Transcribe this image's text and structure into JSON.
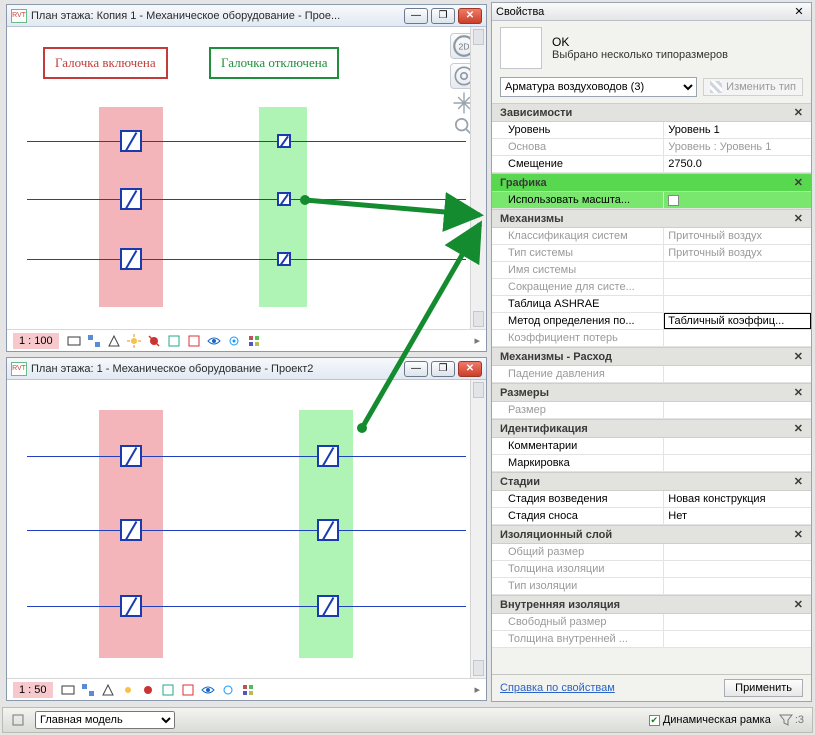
{
  "windows": {
    "top": {
      "title": "План этажа: Копия 1 - Механическое оборудование - Прое...",
      "notes": {
        "on": "Галочка включена",
        "off": "Галочка отключена"
      },
      "scale": "1 : 100"
    },
    "bottom": {
      "title": "План этажа: 1 - Механическое оборудование - Проект2",
      "scale": "1 : 50"
    }
  },
  "properties": {
    "title": "Свойства",
    "head": {
      "l1": "OK",
      "l2": "Выбрано несколько типоразмеров"
    },
    "type_selector": "Арматура воздуховодов (3)",
    "edit_type": "Изменить тип",
    "groups": [
      {
        "name": "Зависимости",
        "rows": [
          {
            "k": "Уровень",
            "v": "Уровень 1",
            "rw": true
          },
          {
            "k": "Основа",
            "v": "Уровень : Уровень 1",
            "rw": false
          },
          {
            "k": "Смещение",
            "v": "2750.0",
            "rw": true
          }
        ]
      },
      {
        "name": "Графика",
        "highlight": true,
        "rows": [
          {
            "k": "Использовать масшта...",
            "v": "",
            "checkbox": true,
            "rw": true
          }
        ]
      },
      {
        "name": "Механизмы",
        "rows": [
          {
            "k": "Классификация систем",
            "v": "Приточный воздух",
            "rw": false
          },
          {
            "k": "Тип системы",
            "v": "Приточный воздух",
            "rw": false
          },
          {
            "k": "Имя системы",
            "v": "",
            "rw": false
          },
          {
            "k": "Сокращение для систе...",
            "v": "",
            "rw": false
          },
          {
            "k": "Таблица ASHRAE",
            "v": "",
            "rw": true
          },
          {
            "k": "Метод определения по...",
            "v": "Табличный коэффиц...",
            "rw": true,
            "boxed": true
          },
          {
            "k": "Коэффициент потерь",
            "v": "",
            "rw": false
          }
        ]
      },
      {
        "name": "Механизмы - Расход",
        "rows": [
          {
            "k": "Падение давления",
            "v": "",
            "rw": false
          }
        ]
      },
      {
        "name": "Размеры",
        "rows": [
          {
            "k": "Размер",
            "v": "",
            "rw": false
          }
        ]
      },
      {
        "name": "Идентификация",
        "rows": [
          {
            "k": "Комментарии",
            "v": "",
            "rw": true
          },
          {
            "k": "Маркировка",
            "v": "",
            "rw": true
          }
        ]
      },
      {
        "name": "Стадии",
        "rows": [
          {
            "k": "Стадия возведения",
            "v": "Новая конструкция",
            "rw": true
          },
          {
            "k": "Стадия сноса",
            "v": "Нет",
            "rw": true
          }
        ]
      },
      {
        "name": "Изоляционный слой",
        "rows": [
          {
            "k": "Общий размер",
            "v": "",
            "rw": false
          },
          {
            "k": "Толщина изоляции",
            "v": "",
            "rw": false
          },
          {
            "k": "Тип изоляции",
            "v": "",
            "rw": false
          }
        ]
      },
      {
        "name": "Внутренняя изоляция",
        "rows": [
          {
            "k": "Свободный размер",
            "v": "",
            "rw": false
          },
          {
            "k": "Толщина внутренней ...",
            "v": "",
            "rw": false
          }
        ]
      }
    ],
    "help": "Справка по свойствам",
    "apply": "Применить"
  },
  "appbar": {
    "view_select": "Главная модель",
    "dyn_frame": "Динамическая рамка",
    "filter_count": ":3"
  }
}
